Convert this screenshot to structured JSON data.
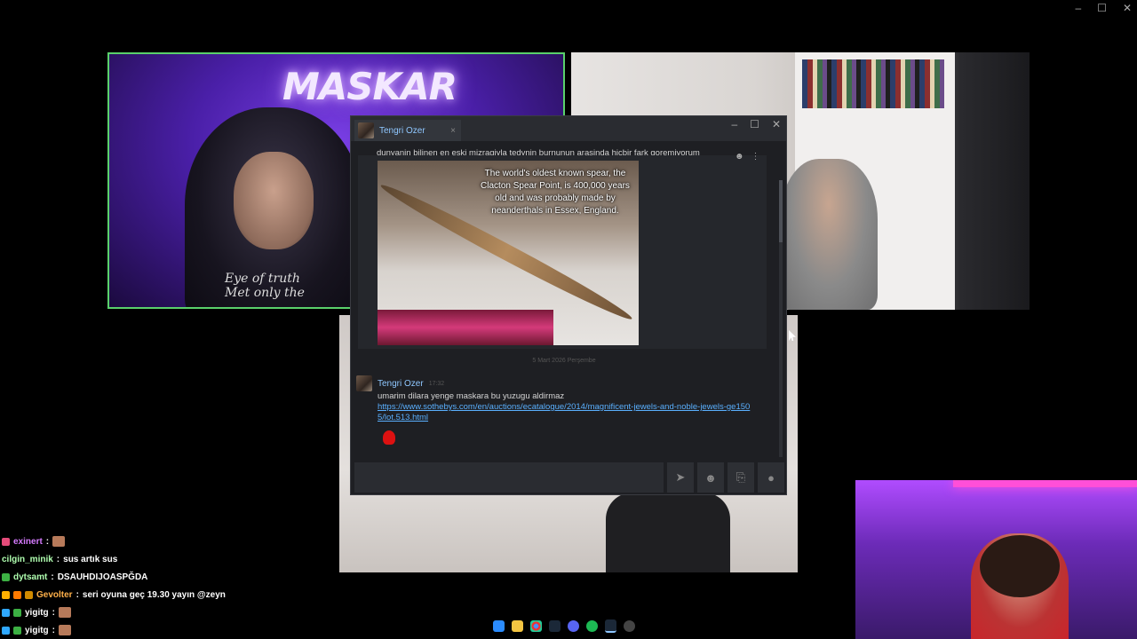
{
  "window_controls": {
    "minimize": "–",
    "maximize": "☐",
    "close": "✕"
  },
  "cams": {
    "cam1_neon": "MASKAR",
    "cam1_shirt": "Eye of truth\nMet only the"
  },
  "chat_window": {
    "tab_name": "Tengri Ozer",
    "tab_close": "×",
    "win_min": "–",
    "win_max": "☐",
    "win_close": "✕",
    "message1_text": "dunyanin bilinen en eski mizragiyla tedynin burnunun arasinda hicbir fark goremiyorum",
    "image_caption": "The world's oldest known spear, the Clacton Spear Point, is 400,000 years old and was probably made by neanderthals in Essex, England.",
    "date_separator": "5 Mart 2026 Perşembe",
    "message2": {
      "name": "Tengri Ozer",
      "time": "17:32",
      "text": "umarim dilara yenge maskara bu yuzugu aldirmaz",
      "link": "https://www.sothebys.com/en/auctions/ecatalogue/2014/magnificent-jewels-and-noble-jewels-ge1505/lot.513.html"
    },
    "input_placeholder": "",
    "icons": {
      "send": "➤",
      "emoji": "☻",
      "attach": "⎘",
      "voice": "●"
    }
  },
  "twitch_chat": [
    {
      "user": "exinert",
      "text": "",
      "color": "#d67bff",
      "badge": "#e54b7a",
      "emote": true
    },
    {
      "user": "cilgin_minik",
      "text": "sus artık sus",
      "color": "#b0ffb0",
      "badge": "",
      "emote": false
    },
    {
      "user": "dytsamt",
      "text": "DSAUHDIJOASPĞDA",
      "color": "#b0ffb0",
      "badge": "#3cb043",
      "emote": false
    },
    {
      "user": "Gevolter",
      "text": "seri oyuna geç 19.30 yayın @zeyn",
      "color": "#ffb14a",
      "badge": "#ffb000",
      "emote": false
    },
    {
      "user": "yigitg",
      "text": "",
      "color": "#ffffff",
      "badge": "#2fa8ff",
      "emote": true
    },
    {
      "user": "yigitg",
      "text": "",
      "color": "#ffffff",
      "badge": "#2fa8ff",
      "emote": true
    }
  ],
  "taskbar_icons": [
    "windows-icon",
    "files-icon",
    "chrome-icon",
    "steam-icon",
    "discord-icon",
    "spotify-icon",
    "app-icon",
    "settings-icon"
  ]
}
